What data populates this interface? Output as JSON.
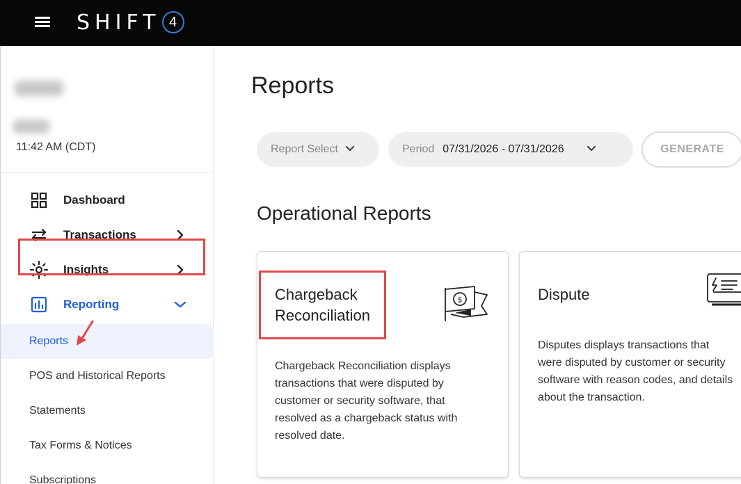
{
  "header": {
    "brand_text": "SHIFT",
    "brand_number": "4",
    "accent_color": "#2f7fd8"
  },
  "sidebar": {
    "time": "11:42 AM (CDT)",
    "nav": [
      {
        "label": "Dashboard",
        "icon": "dashboard-grid-icon"
      },
      {
        "label": "Transactions",
        "icon": "transfer-arrows-icon"
      },
      {
        "label": "Insights",
        "icon": "insights-sparkle-icon"
      },
      {
        "label": "Reporting",
        "icon": "bar-chart-icon"
      }
    ],
    "subitems": [
      {
        "label": "Reports"
      },
      {
        "label": "POS and Historical Reports"
      },
      {
        "label": "Statements"
      },
      {
        "label": "Tax Forms & Notices"
      },
      {
        "label": "Subscriptions"
      }
    ]
  },
  "main": {
    "title": "Reports",
    "filters": {
      "report_select": "Report Select",
      "period_label": "Period",
      "period_value": "07/31/2026 - 07/31/2026",
      "generate": "GENERATE"
    },
    "section_title": "Operational Reports",
    "cards": [
      {
        "title_line1": "Chargeback",
        "title_line2": "Reconciliation",
        "icon": "chargeback-flag-icon",
        "desc": [
          "Chargeback Reconciliation displays",
          "transactions that were disputed by",
          "customer or security software, that",
          "resolved as a chargeback status with",
          "resolved date."
        ]
      },
      {
        "title": "Dispute",
        "icon": "dispute-document-icon",
        "desc": [
          "Disputes displays transactions that",
          "were disputed by customer or security",
          "software with reason codes, and details",
          "about the transaction."
        ]
      }
    ]
  },
  "colors": {
    "active": "#1d5ed8",
    "highlight": "#e04848",
    "topbar": "#070707"
  }
}
